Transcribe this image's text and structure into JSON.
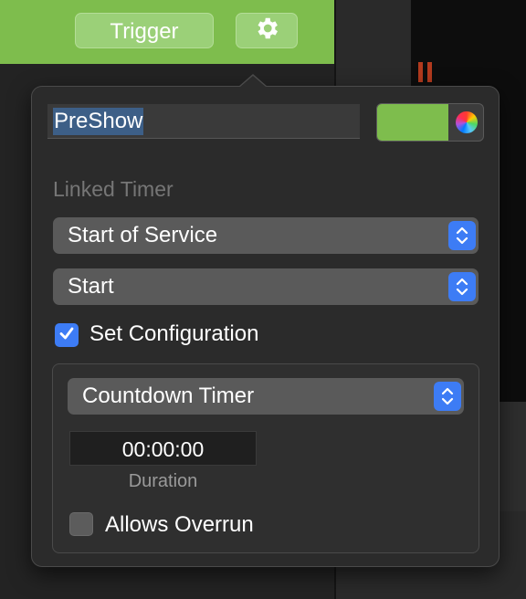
{
  "topbar": {
    "trigger_label": "Trigger",
    "settings_icon": "gear-icon",
    "color": "#7ebd4d"
  },
  "popover": {
    "name_value": "PreShow",
    "color_swatch": "#7ebd4d",
    "color_picker_icon": "color-wheel-icon",
    "linked_timer_label": "Linked Timer",
    "linked_timer_select": "Start of Service",
    "action_select": "Start",
    "set_configuration_label": "Set Configuration",
    "set_configuration_checked": true,
    "config": {
      "timer_type_select": "Countdown Timer",
      "duration_value": "00:00:00",
      "duration_label": "Duration",
      "allows_overrun_label": "Allows Overrun",
      "allows_overrun_checked": false
    }
  },
  "colors": {
    "accent_blue": "#3d7cf5",
    "popover_bg": "#2b2b2b",
    "selection": "#3d5f87"
  }
}
